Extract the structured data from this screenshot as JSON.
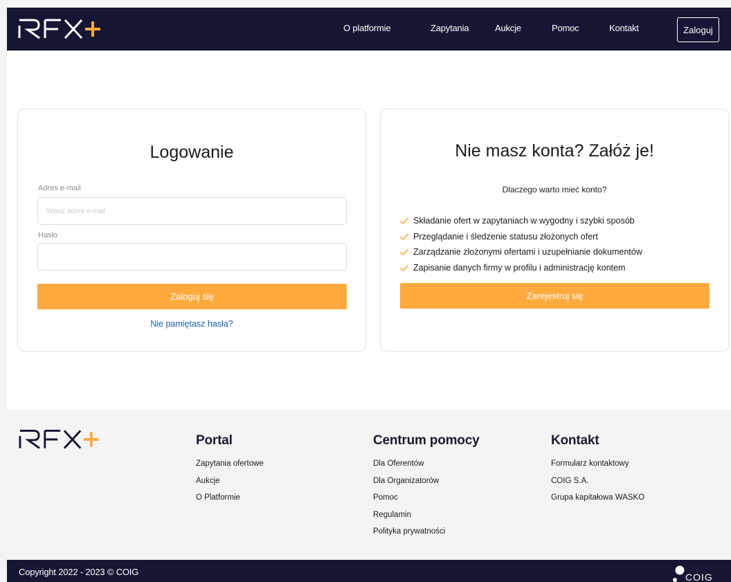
{
  "brand": {
    "logo_text": "RFX+",
    "accent_color": "#ffaa3f",
    "navy_color": "#141633"
  },
  "nav": {
    "items": [
      "O platformie",
      "Zapytania",
      "Aukcje",
      "Pomoc",
      "Kontakt"
    ],
    "login_label": "Zaloguj"
  },
  "login": {
    "title": "Logowanie",
    "email_label": "Adres e-mail",
    "email_placeholder": "Wpisz adres e-mail",
    "email_value": "",
    "password_label": "Hasło",
    "password_value": "",
    "submit_label": "Zaloguj się",
    "forgot_label": "Nie pamiętasz hasła?"
  },
  "register": {
    "title": "Nie masz konta? Załóż je!",
    "subtitle": "Dlaczego warto mieć konto?",
    "benefits": [
      "Składanie ofert w zapytaniach w wygodny i szybki sposób",
      "Przeglądanie i śledzenie statusu złożonych ofert",
      "Zarządzanie złożonymi ofertami i uzupełnianie dokumentów",
      "Zapisanie danych firmy w profilu i administrację kontem"
    ],
    "submit_label": "Zarejestruj się"
  },
  "footer": {
    "columns": [
      {
        "title": "Portal",
        "links": [
          "Zapytania ofertowe",
          "Aukcje",
          "O Platformie"
        ]
      },
      {
        "title": "Centrum pomocy",
        "links": [
          "Dla Oferentów",
          "Dla Organizatorów",
          "Pomoc",
          "Regulamin",
          "Polityka prywatności"
        ]
      },
      {
        "title": "Kontakt",
        "links": [
          "Formularz kontaktowy",
          "COIG S.A.",
          "Grupa kapitałowa WASKO"
        ]
      }
    ],
    "copyright": "Copyright 2022 - 2023 © COIG",
    "coig_logo_text": "COIG"
  }
}
